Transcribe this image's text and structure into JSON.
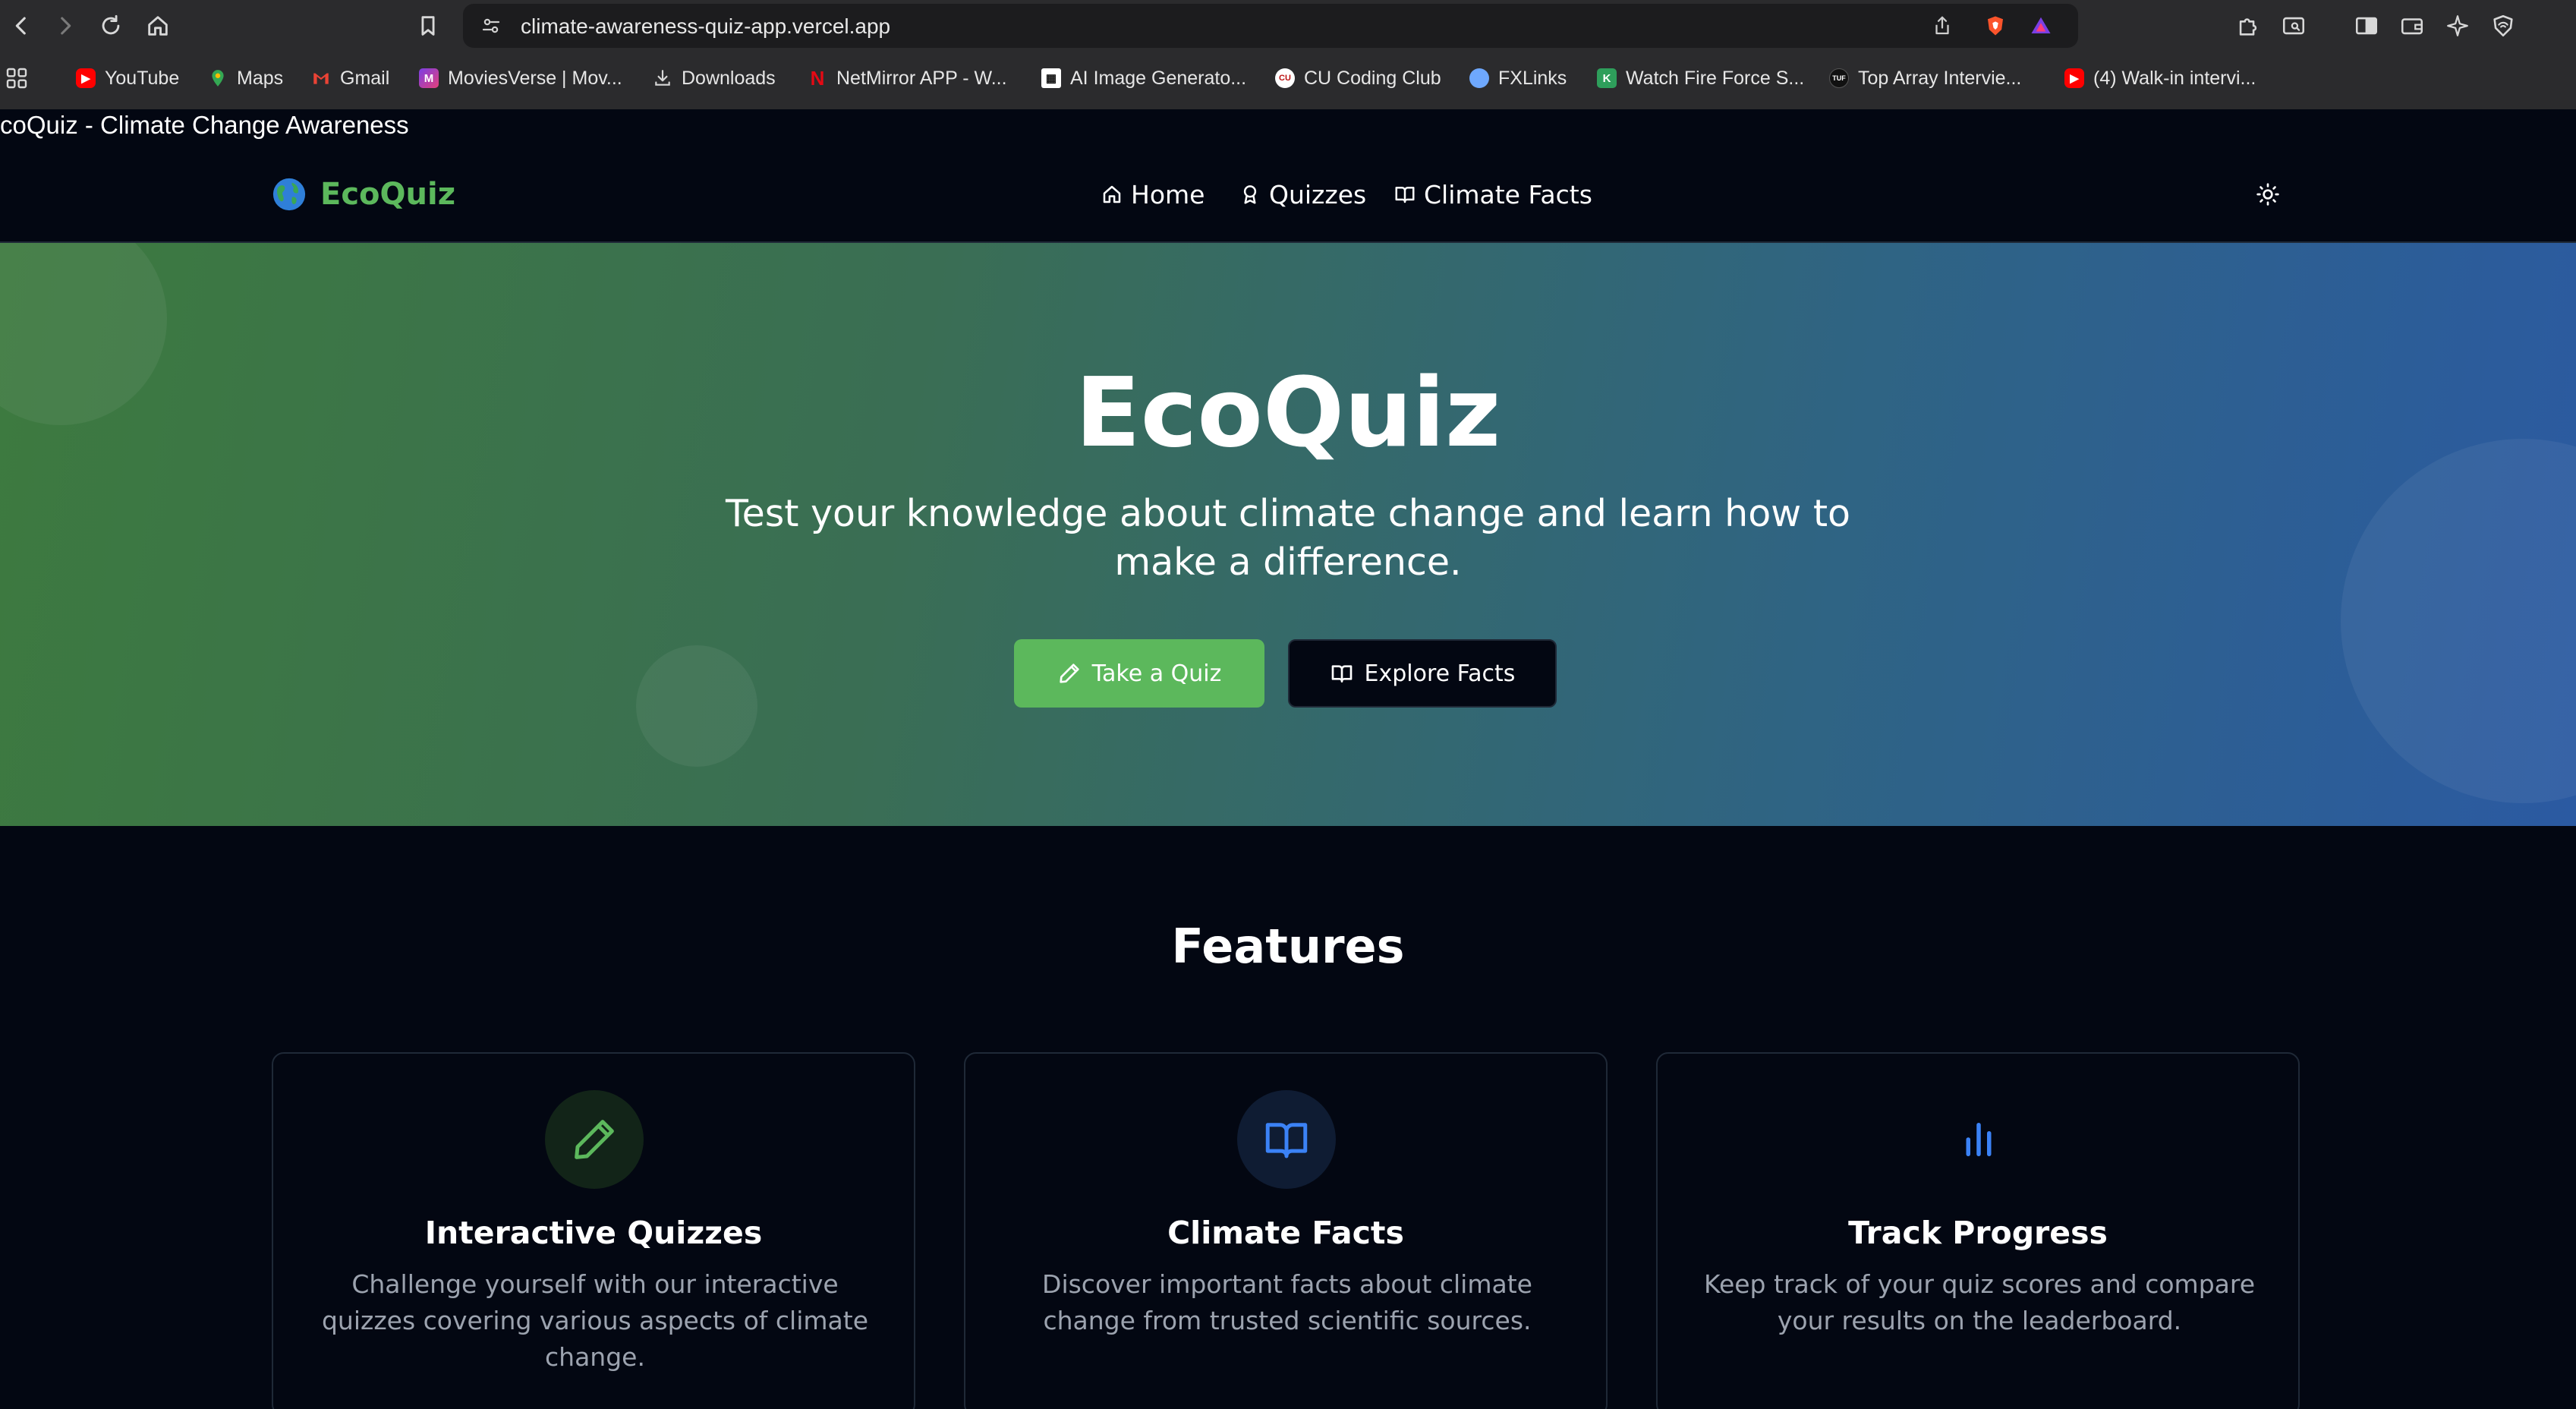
{
  "browser": {
    "url": "climate-awareness-quiz-app.vercel.app",
    "bookmarks": [
      {
        "label": "YouTube",
        "icon": "youtube-icon",
        "color": "#ff0000"
      },
      {
        "label": "Maps",
        "icon": "maps-icon",
        "color": "#34a853"
      },
      {
        "label": "Gmail",
        "icon": "gmail-icon",
        "color": "#ea4335"
      },
      {
        "label": "MoviesVerse | Mov...",
        "icon": "moviesverse-icon",
        "color": "#7b3fe4"
      },
      {
        "label": "Downloads",
        "icon": "download-icon",
        "color": "#cccccc"
      },
      {
        "label": "NetMirror APP - W...",
        "icon": "netmirror-icon",
        "color": "#e50914"
      },
      {
        "label": "AI Image Generato...",
        "icon": "ai-image-icon",
        "color": "#ffffff"
      },
      {
        "label": "CU Coding Club",
        "icon": "cu-coding-club-icon",
        "color": "#ffffff"
      },
      {
        "label": "FXLinks",
        "icon": "fxlinks-icon",
        "color": "#6ea8fe"
      },
      {
        "label": "Watch Fire Force S...",
        "icon": "watch-icon",
        "color": "#2e9e5b"
      },
      {
        "label": "Top Array Intervie...",
        "icon": "tuf-icon",
        "color": "#111111"
      },
      {
        "label": "(4) Walk-in intervi...",
        "icon": "youtube-icon",
        "color": "#ff0000"
      }
    ]
  },
  "page": {
    "document_title": "coQuiz - Climate Change Awareness"
  },
  "nav": {
    "brand": "EcoQuiz",
    "links": [
      {
        "label": "Home",
        "icon": "home-icon"
      },
      {
        "label": "Quizzes",
        "icon": "award-icon"
      },
      {
        "label": "Climate Facts",
        "icon": "book-icon"
      }
    ],
    "theme_toggle_icon": "sun-icon"
  },
  "hero": {
    "title": "EcoQuiz",
    "subtitle": "Test your knowledge about climate change and learn how to make a difference.",
    "primary_button": "Take a Quiz",
    "secondary_button": "Explore Facts"
  },
  "features": {
    "title": "Features",
    "items": [
      {
        "title": "Interactive Quizzes",
        "description": "Challenge yourself with our interactive quizzes covering various aspects of climate change.",
        "icon": "pencil-icon",
        "color": "#5cb85c"
      },
      {
        "title": "Climate Facts",
        "description": "Discover important facts about climate change from trusted scientific sources.",
        "icon": "book-open-icon",
        "color": "#3b82f6"
      },
      {
        "title": "Track Progress",
        "description": "Keep track of your quiz scores and compare your results on the leaderboard.",
        "icon": "bar-chart-icon",
        "color": "#3b82f6"
      }
    ]
  },
  "colors": {
    "brand_green": "#5cb85c",
    "accent_blue": "#3b82f6",
    "page_bg": "#030712"
  }
}
